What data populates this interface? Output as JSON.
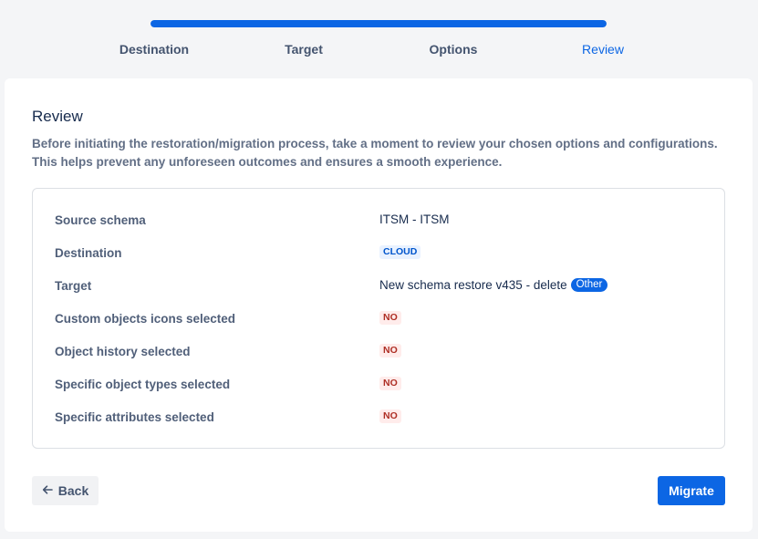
{
  "progress": {
    "fraction": 1.0,
    "color": "#0c66e4"
  },
  "steps": [
    {
      "label": "Destination"
    },
    {
      "label": "Target"
    },
    {
      "label": "Options"
    },
    {
      "label": "Review"
    }
  ],
  "review": {
    "title": "Review",
    "description": "Before initiating the restoration/migration process, take a moment to review your chosen options and configurations. This helps prevent any unforeseen outcomes and ensures a smooth experience."
  },
  "summary": {
    "source_schema": {
      "label": "Source schema",
      "value": "ITSM - ITSM"
    },
    "destination": {
      "label": "Destination",
      "value": "CLOUD"
    },
    "target": {
      "label": "Target",
      "value": "New schema restore v435 - delete",
      "badge": "Other"
    },
    "custom_icons": {
      "label": "Custom objects icons selected",
      "value": "NO"
    },
    "object_history": {
      "label": "Object history selected",
      "value": "NO"
    },
    "object_types": {
      "label": "Specific object types selected",
      "value": "NO"
    },
    "attributes": {
      "label": "Specific attributes selected",
      "value": "NO"
    }
  },
  "actions": {
    "back_label": "Back",
    "back_icon": "arrow-left-icon",
    "migrate_label": "Migrate"
  }
}
